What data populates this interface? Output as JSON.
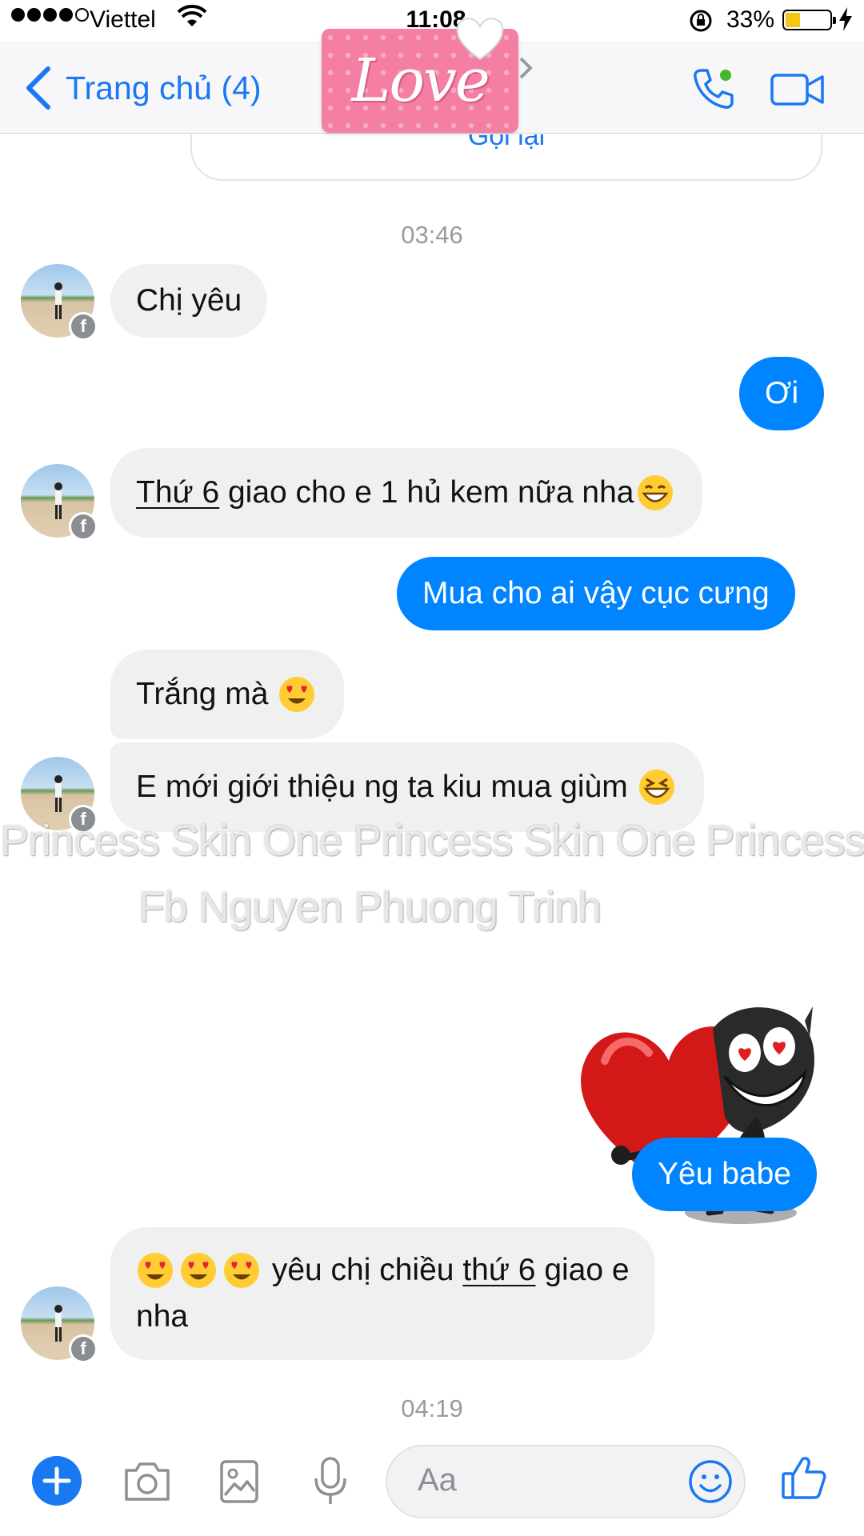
{
  "status_bar": {
    "carrier": "Viettel",
    "time": "11:08",
    "battery_percent": "33%",
    "battery_level": 0.33,
    "signal_bars": 4
  },
  "nav": {
    "back_label": "Trang chủ (4)",
    "sticker_text": "Love"
  },
  "call_card": {
    "call_back_label": "Gọi lại"
  },
  "timestamps": [
    "03:46",
    "04:19"
  ],
  "messages": [
    {
      "dir": "in",
      "text": "Chị yêu"
    },
    {
      "dir": "out",
      "text": "Ơi"
    },
    {
      "dir": "in",
      "text_underlined": "Thứ 6",
      "text_rest": " giao cho e 1 hủ kem nữa nha",
      "emoji": "grinning-face"
    },
    {
      "dir": "out",
      "text": "Mua cho ai vậy cục cưng"
    },
    {
      "dir": "in",
      "text": "Trắng mà",
      "emoji": "heart-eyes-face"
    },
    {
      "dir": "in",
      "text": "E mới giới thiệu ng ta kiu mua giùm",
      "emoji": "laughing-face"
    },
    {
      "dir": "out",
      "sticker": "heart-holding-character"
    },
    {
      "dir": "out",
      "text": "Yêu babe"
    },
    {
      "dir": "in",
      "emoji_prefix": [
        "heart-eyes-face",
        "heart-eyes-face",
        "heart-eyes-face"
      ],
      "text_pre": " yêu chị chiều ",
      "text_underlined": "thứ 6",
      "text_post": " giao e",
      "text_line2": "nha"
    }
  ],
  "watermark": {
    "line1": "Princess Skin One Princess Skin One Princess Skin One",
    "line2": "Fb Nguyen Phuong Trinh"
  },
  "composer": {
    "placeholder": "Aa"
  },
  "colors": {
    "accent": "#1a78f2",
    "outgoing_bubble": "#0084ff",
    "incoming_bubble": "#f0f0f0",
    "timestamp": "#9a9aa0"
  }
}
